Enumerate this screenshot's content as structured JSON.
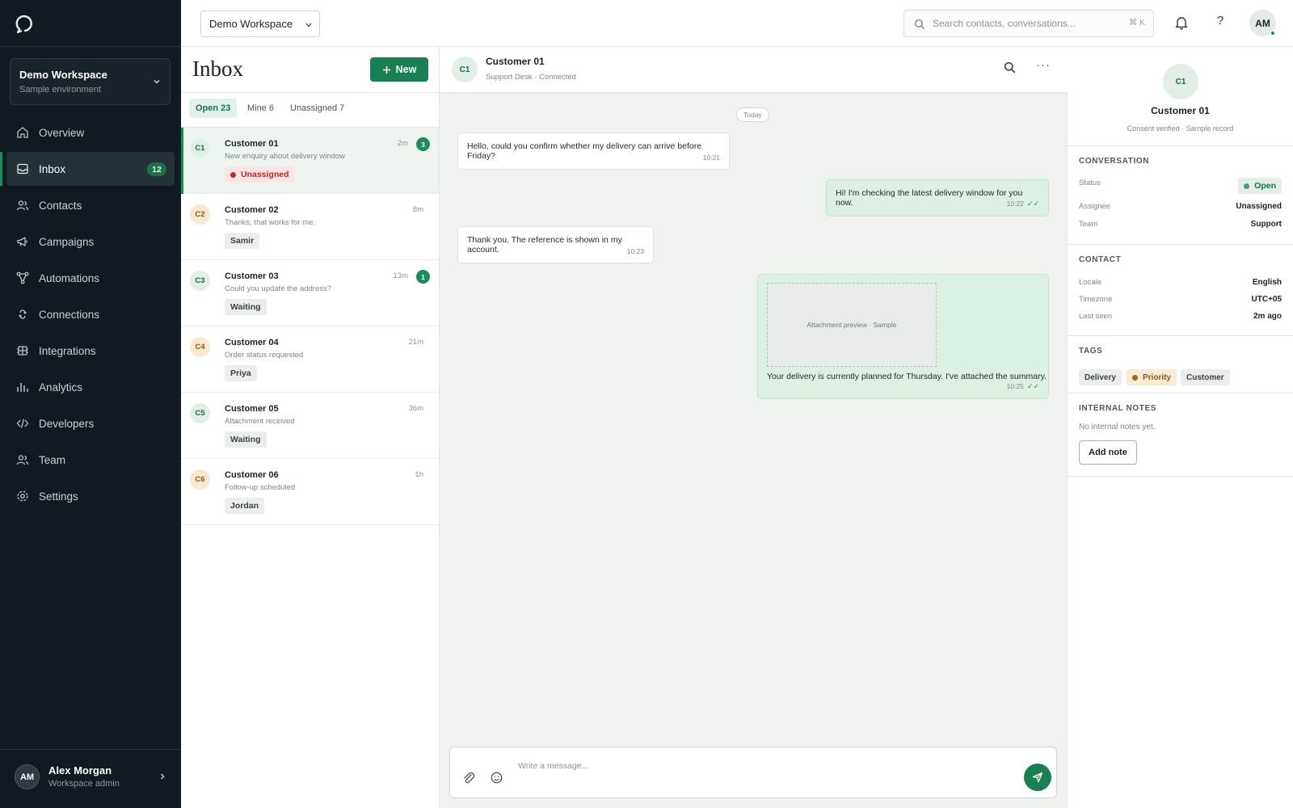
{
  "workspace": {
    "name": "Demo Workspace",
    "subtitle": "Sample environment"
  },
  "nav": [
    {
      "label": "Overview",
      "icon": "home-icon"
    },
    {
      "label": "Inbox",
      "icon": "inbox-icon",
      "badge": "12",
      "active": true
    },
    {
      "label": "Contacts",
      "icon": "users-icon"
    },
    {
      "label": "Campaigns",
      "icon": "megaphone-icon"
    },
    {
      "label": "Automations",
      "icon": "flow-icon"
    },
    {
      "label": "Connections",
      "icon": "link-icon"
    },
    {
      "label": "Integrations",
      "icon": "grid-icon"
    },
    {
      "label": "Analytics",
      "icon": "bar-chart-icon"
    },
    {
      "label": "Developers",
      "icon": "code-icon"
    },
    {
      "label": "Team",
      "icon": "team-icon"
    },
    {
      "label": "Settings",
      "icon": "gear-icon"
    }
  ],
  "user": {
    "initials": "AM",
    "name": "Alex Morgan",
    "role": "Workspace admin"
  },
  "topbar": {
    "workspace_select": "Demo Workspace",
    "search_placeholder": "Search contacts, conversations...",
    "search_shortcut": "⌘ K",
    "help_label": "?",
    "avatar_initials": "AM"
  },
  "inbox": {
    "title": "Inbox",
    "new_label": "New",
    "tabs": [
      {
        "label": "Open 23",
        "active": true
      },
      {
        "label": "Mine 6"
      },
      {
        "label": "Unassigned 7"
      }
    ],
    "conversations": [
      {
        "initials": "C1",
        "name": "Customer 01",
        "time": "2m",
        "preview": "New enquiry about delivery window",
        "tag": "Unassigned",
        "unread": "3",
        "avatar": "green",
        "active": true
      },
      {
        "initials": "C2",
        "name": "Customer 02",
        "time": "8m",
        "preview": "Thanks, that works for me.",
        "tag": "Samir",
        "avatar": "amber"
      },
      {
        "initials": "C3",
        "name": "Customer 03",
        "time": "13m",
        "preview": "Could you update the address?",
        "tag": "Waiting",
        "unread": "1",
        "avatar": "green"
      },
      {
        "initials": "C4",
        "name": "Customer 04",
        "time": "21m",
        "preview": "Order status requested",
        "tag": "Priya",
        "avatar": "amber"
      },
      {
        "initials": "C5",
        "name": "Customer 05",
        "time": "36m",
        "preview": "Attachment received",
        "tag": "Waiting",
        "avatar": "green"
      },
      {
        "initials": "C6",
        "name": "Customer 06",
        "time": "1h",
        "preview": "Follow-up scheduled",
        "tag": "Jordan",
        "avatar": "amber"
      }
    ]
  },
  "chat": {
    "initials": "C1",
    "name": "Customer 01",
    "subtitle": "Support Desk · Connected",
    "more_label": "···",
    "day": "Today",
    "messages": [
      {
        "direction": "in",
        "text": "Hello, could you confirm whether my delivery can arrive before Friday?",
        "time": "10:21"
      },
      {
        "direction": "out",
        "text": "Hi! I'm checking the latest delivery window for you now.",
        "time": "10:22",
        "ticks": "✓✓"
      },
      {
        "direction": "in",
        "text": "Thank you. The reference is shown in my account.",
        "time": "10:23"
      },
      {
        "direction": "out",
        "attachment": "Attachment preview · Sample",
        "text": "Your delivery is currently planned for Thursday. I've attached the summary.",
        "time": "10:25",
        "ticks": "✓✓"
      }
    ],
    "composer_placeholder": "Write a message..."
  },
  "details": {
    "initials": "C1",
    "name": "Customer 01",
    "subtitle": "Consent verified · Sample record",
    "conversation": {
      "heading": "CONVERSATION",
      "status_label": "Status",
      "status_value": "Open",
      "assignee_label": "Assignee",
      "assignee_value": "Unassigned",
      "team_label": "Team",
      "team_value": "Support"
    },
    "contact": {
      "heading": "CONTACT",
      "locale_label": "Locale",
      "locale_value": "English",
      "timezone_label": "Timezone",
      "timezone_value": "UTC+05",
      "last_seen_label": "Last seen",
      "last_seen_value": "2m ago"
    },
    "tags": {
      "heading": "TAGS",
      "items": [
        "Delivery",
        "Priority",
        "Customer"
      ]
    },
    "notes": {
      "heading": "INTERNAL NOTES",
      "empty": "No internal notes yet.",
      "add_label": "Add note"
    }
  },
  "colors": {
    "accent": "#1a7f53",
    "sidebar_bg": "#111a20",
    "danger": "#c2282b",
    "warning": "#a8621d"
  }
}
